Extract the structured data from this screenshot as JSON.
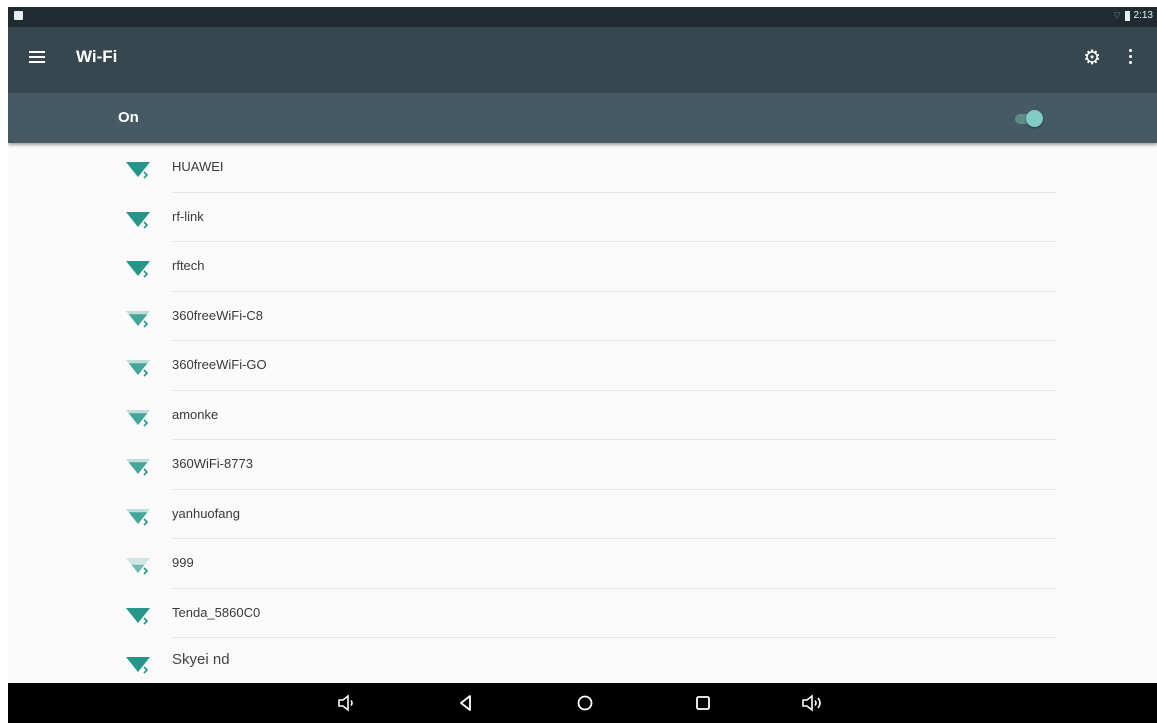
{
  "statusbar": {
    "time": "2:13"
  },
  "appbar": {
    "title": "Wi-Fi",
    "icons": [
      "menu-icon",
      "gear-icon",
      "more-vert-icon"
    ]
  },
  "wifi_switch": {
    "label": "On",
    "enabled": true,
    "accent_color": "#80cbc4"
  },
  "networks": [
    {
      "ssid": "HUAWEI",
      "signal": "strong"
    },
    {
      "ssid": "rf-link",
      "signal": "strong"
    },
    {
      "ssid": "rftech",
      "signal": "strong"
    },
    {
      "ssid": "360freeWiFi-C8",
      "signal": "medium"
    },
    {
      "ssid": "360freeWiFi-GO",
      "signal": "medium"
    },
    {
      "ssid": "amonke",
      "signal": "medium"
    },
    {
      "ssid": "360WiFi-8773",
      "signal": "medium"
    },
    {
      "ssid": "yanhuofang",
      "signal": "medium"
    },
    {
      "ssid": "999",
      "signal": "weak"
    },
    {
      "ssid": "Tenda_5860C0",
      "signal": "strong"
    },
    {
      "ssid": "Skyei nd",
      "signal": "strong"
    }
  ],
  "colors": {
    "appbar": "#37474f",
    "switchbar": "#455a64",
    "wifi_icon": "#26968a",
    "navbar": "#000000"
  },
  "navbar": {
    "buttons": [
      "volume-down-icon",
      "back-icon",
      "home-icon",
      "recents-icon",
      "volume-up-icon"
    ]
  }
}
